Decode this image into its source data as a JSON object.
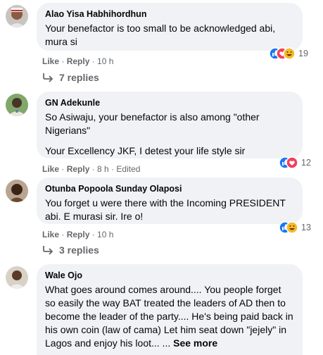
{
  "comments": [
    {
      "author": "Alao Yisa Habhihordhun",
      "text": "Your benefactor is too small to be acknowledged abi, mura si",
      "like": "Like",
      "reply": "Reply",
      "time": "10 h",
      "reactions": "19",
      "replies": "7 replies"
    },
    {
      "author": "GN Adekunle",
      "text": "So Asiwaju, your benefactor is also among \"other Nigerians\"",
      "text2": "Your Excellency JKF, I detest your life style sir",
      "like": "Like",
      "reply": "Reply",
      "time": "8 h",
      "edited": "Edited",
      "reactions": "12"
    },
    {
      "author": "Otunba Popoola Sunday Olaposi",
      "text": "You forget u were there with the Incoming PRESIDENT abi. E murasi sir. Ire o!",
      "like": "Like",
      "reply": "Reply",
      "time": "10 h",
      "reactions": "13",
      "replies": "3 replies"
    },
    {
      "author": "Wale Ojo",
      "text": "What goes around comes around.... You people forget so easily the way BAT treated the leaders of AD then to become the leader of the party.... He's being paid back in his own coin (law of cama) Let him seat down \"jejely\" in Lagos and enjoy his loot... ...",
      "see_more": "See more"
    }
  ],
  "colors": {
    "like": "#1877f2",
    "love": "#f33e58",
    "haha": "#f7b928",
    "bubble": "#f0f2f5",
    "meta": "#65676b"
  }
}
